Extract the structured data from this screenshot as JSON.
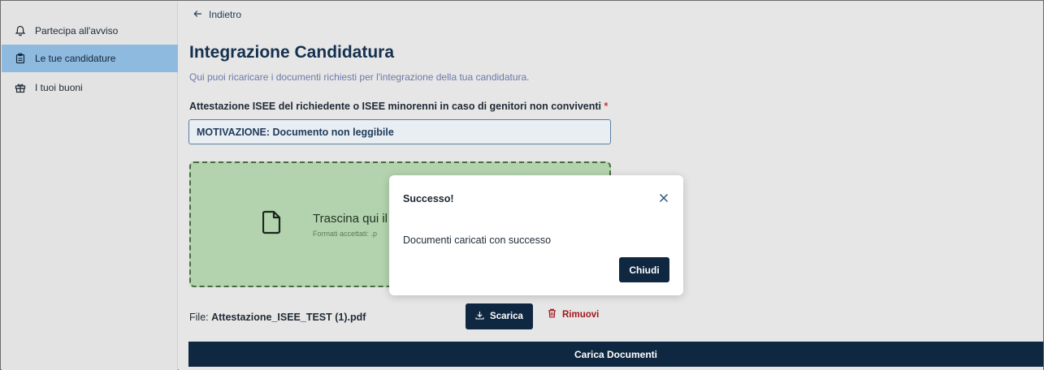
{
  "sidebar": {
    "items": [
      {
        "label": "Partecipa all'avviso",
        "icon": "bell-icon"
      },
      {
        "label": "Le tue candidature",
        "icon": "clipboard-icon",
        "active": true
      },
      {
        "label": "I tuoi buoni",
        "icon": "gift-icon"
      }
    ]
  },
  "main": {
    "back_label": "Indietro",
    "title": "Integrazione Candidatura",
    "subtitle": "Qui puoi ricaricare i documenti richiesti per l'integrazione della tua candidatura.",
    "doc_label": "Attestazione ISEE del richiedente o ISEE minorenni in caso di genitori non conviventi",
    "required_marker": "*",
    "motivation": "MOTIVAZIONE: Documento non leggibile",
    "dropzone": {
      "text": "Trascina qui il",
      "formats": "Formati accettati: .p"
    },
    "file": {
      "prefix": "File:",
      "name": "Attestazione_ISEE_TEST (1).pdf"
    },
    "download_label": "Scarica",
    "remove_label": "Rimuovi",
    "upload_label": "Carica Documenti"
  },
  "modal": {
    "title": "Successo!",
    "body": "Documenti caricati con successo",
    "close_button": "Chiudi"
  },
  "colors": {
    "primary": "#0f2741",
    "sidebar_active": "#8fbadf",
    "dropzone": "#b2d3ad",
    "danger": "#a3151c",
    "required": "#d2333a"
  }
}
